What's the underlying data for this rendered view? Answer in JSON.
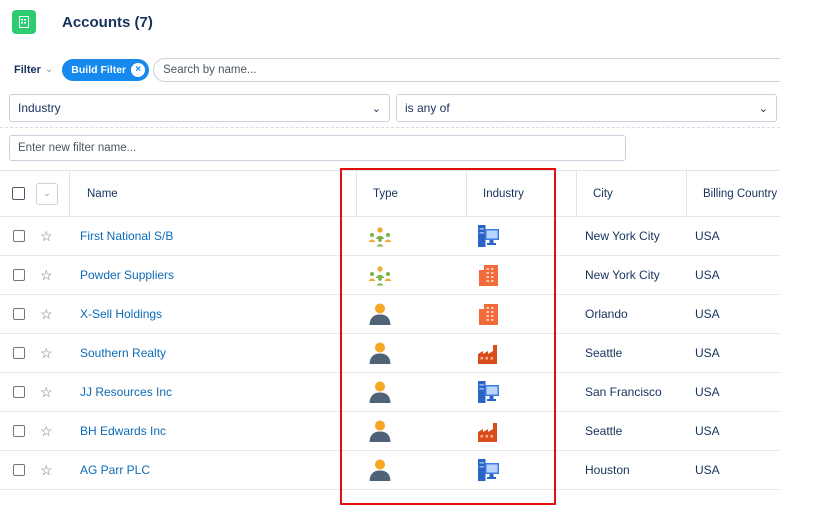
{
  "header": {
    "title": "Accounts (7)",
    "app_icon": "building-icon",
    "app_icon_color": "#2ecc71"
  },
  "filter_bar": {
    "filter_label": "Filter",
    "build_filter_label": "Build Filter",
    "search_placeholder": "Search by name..."
  },
  "filter_row": {
    "field_value": "Industry",
    "operator_value": "is any of",
    "filter_name_placeholder": "Enter new filter name..."
  },
  "table": {
    "columns": [
      "Name",
      "Type",
      "Industry",
      "City",
      "Billing Country"
    ],
    "rows": [
      {
        "name": "First National S/B",
        "type_icon": "group-icon",
        "industry_icon": "computer-icon",
        "city": "New York City",
        "country": "USA"
      },
      {
        "name": "Powder Suppliers",
        "type_icon": "group-icon",
        "industry_icon": "office-building-icon",
        "city": "New York City",
        "country": "USA"
      },
      {
        "name": "X-Sell Holdings",
        "type_icon": "person-icon",
        "industry_icon": "office-building-icon",
        "city": "Orlando",
        "country": "USA"
      },
      {
        "name": "Southern Realty",
        "type_icon": "person-icon",
        "industry_icon": "factory-icon",
        "city": "Seattle",
        "country": "USA"
      },
      {
        "name": "JJ Resources Inc",
        "type_icon": "person-icon",
        "industry_icon": "computer-icon",
        "city": "San Francisco",
        "country": "USA"
      },
      {
        "name": "BH Edwards Inc",
        "type_icon": "person-icon",
        "industry_icon": "factory-icon",
        "city": "Seattle",
        "country": "USA"
      },
      {
        "name": "AG Parr PLC",
        "type_icon": "person-icon",
        "industry_icon": "computer-icon",
        "city": "Houston",
        "country": "USA"
      }
    ]
  },
  "colors": {
    "accent": "#1589ee",
    "link": "#0b6bb8",
    "highlight_box": "#e01010"
  }
}
